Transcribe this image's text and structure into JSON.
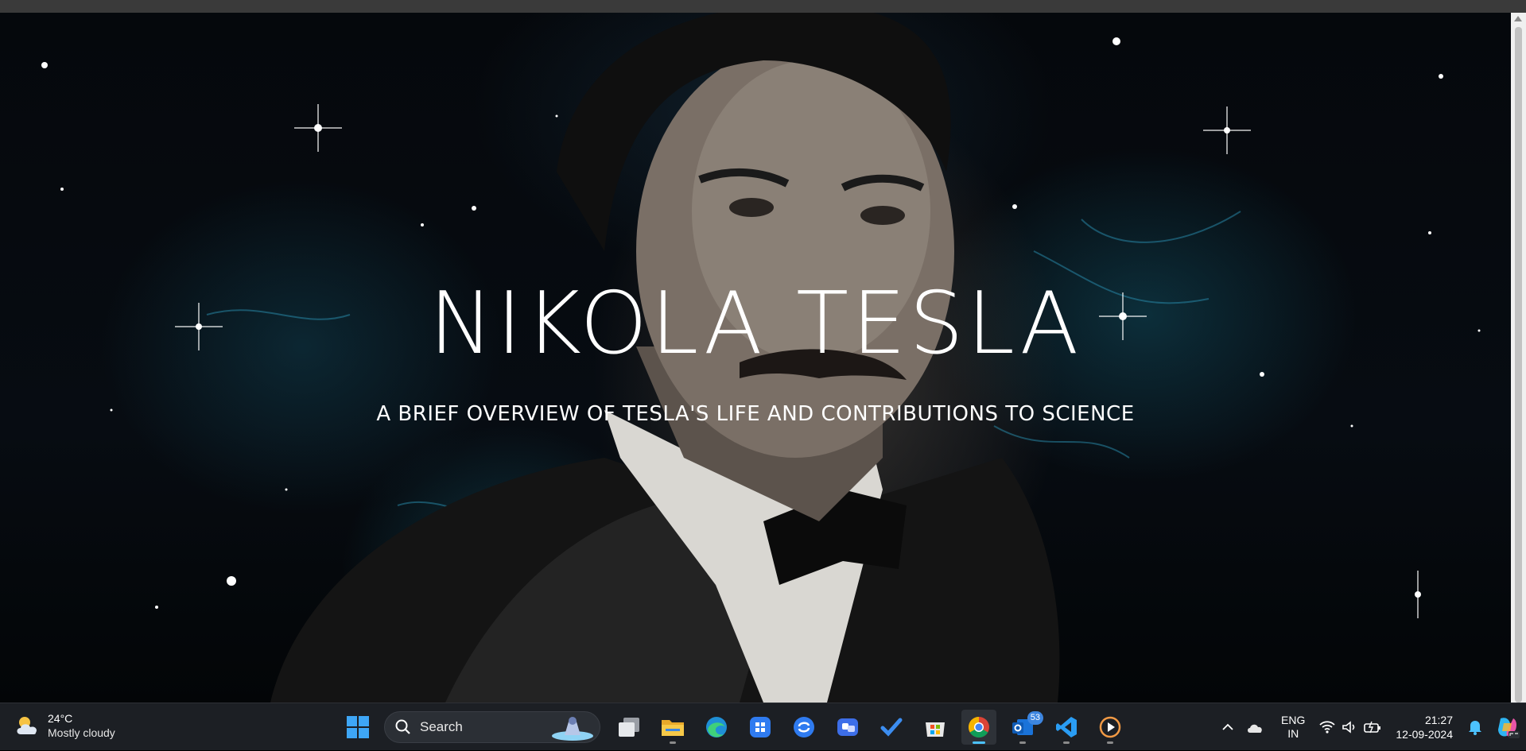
{
  "hero": {
    "title": "NIKOLA TESLA",
    "subtitle": "A BRIEF OVERVIEW OF TESLA'S LIFE AND CONTRIBUTIONS TO SCIENCE"
  },
  "taskbar": {
    "weather": {
      "temperature": "24°C",
      "condition": "Mostly cloudy"
    },
    "search": {
      "label": "Search"
    },
    "apps": [
      {
        "name": "start",
        "icon": "windows-logo-icon"
      },
      {
        "name": "task-view",
        "icon": "task-view-icon"
      },
      {
        "name": "file-explorer",
        "icon": "folder-icon"
      },
      {
        "name": "edge",
        "icon": "edge-icon"
      },
      {
        "name": "app-launcher",
        "icon": "app-grid-icon"
      },
      {
        "name": "sync-app",
        "icon": "sync-icon"
      },
      {
        "name": "teams",
        "icon": "teams-icon"
      },
      {
        "name": "todo",
        "icon": "checkmark-icon"
      },
      {
        "name": "store",
        "icon": "store-icon"
      },
      {
        "name": "chrome",
        "icon": "chrome-icon",
        "active": true
      },
      {
        "name": "outlook",
        "icon": "mail-icon",
        "badge": "53"
      },
      {
        "name": "vscode",
        "icon": "vscode-icon"
      },
      {
        "name": "media-player",
        "icon": "play-icon"
      }
    ],
    "tray": {
      "language": {
        "line1": "ENG",
        "line2": "IN"
      },
      "time": "21:27",
      "date": "12-09-2024"
    }
  },
  "colors": {
    "accent": "#4cc2ff",
    "taskbar": "#1c1f24",
    "badge": "#3d86e0"
  }
}
